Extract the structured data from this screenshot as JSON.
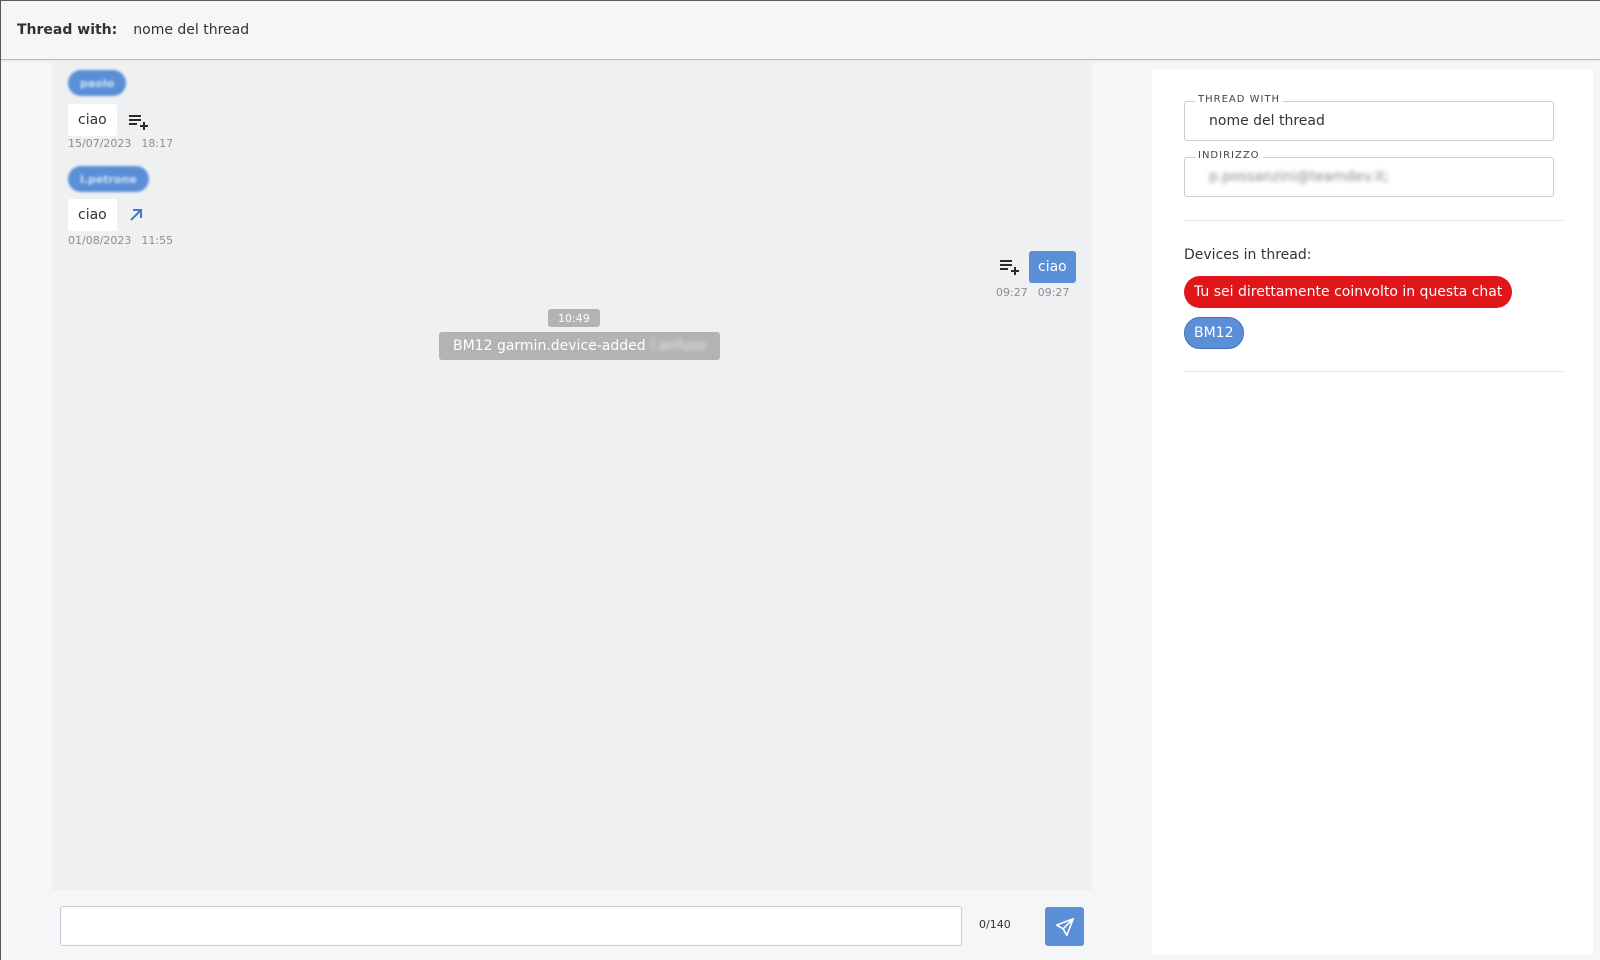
{
  "header": {
    "label": "Thread with:",
    "value": "nome del thread"
  },
  "messages": {
    "m1": {
      "sender": "paolo",
      "text": "ciao",
      "date": "15/07/2023",
      "time": "18:17",
      "action_icon": "playlist-add-icon"
    },
    "m2": {
      "sender": "l.petrone",
      "text": "ciao",
      "date": "01/08/2023",
      "time": "11:55",
      "action_icon": "arrow-up-right-icon"
    },
    "m3": {
      "text": "ciao",
      "time_a": "09:27",
      "time_b": "09:27",
      "action_icon": "playlist-add-icon"
    }
  },
  "system": {
    "time": "10:49",
    "text": "BM12 garmin.device-added",
    "blurred_name": "l.anfuso"
  },
  "composer": {
    "value": "",
    "placeholder": "",
    "counter": "0/140",
    "send_icon": "send-icon"
  },
  "panel": {
    "thread_with_label": "THREAD WITH",
    "thread_with_value": "nome del thread",
    "address_label": "INDIRIZZO",
    "address_value": "p.possanzini@teamdev.it;",
    "devices_title": "Devices in thread:",
    "direct_chip": "Tu sei direttamente coinvolto in questa chat",
    "device_chip": "BM12"
  },
  "colors": {
    "accent": "#5b8fd7",
    "danger": "#e0161a",
    "system": "#b3b3b3"
  }
}
